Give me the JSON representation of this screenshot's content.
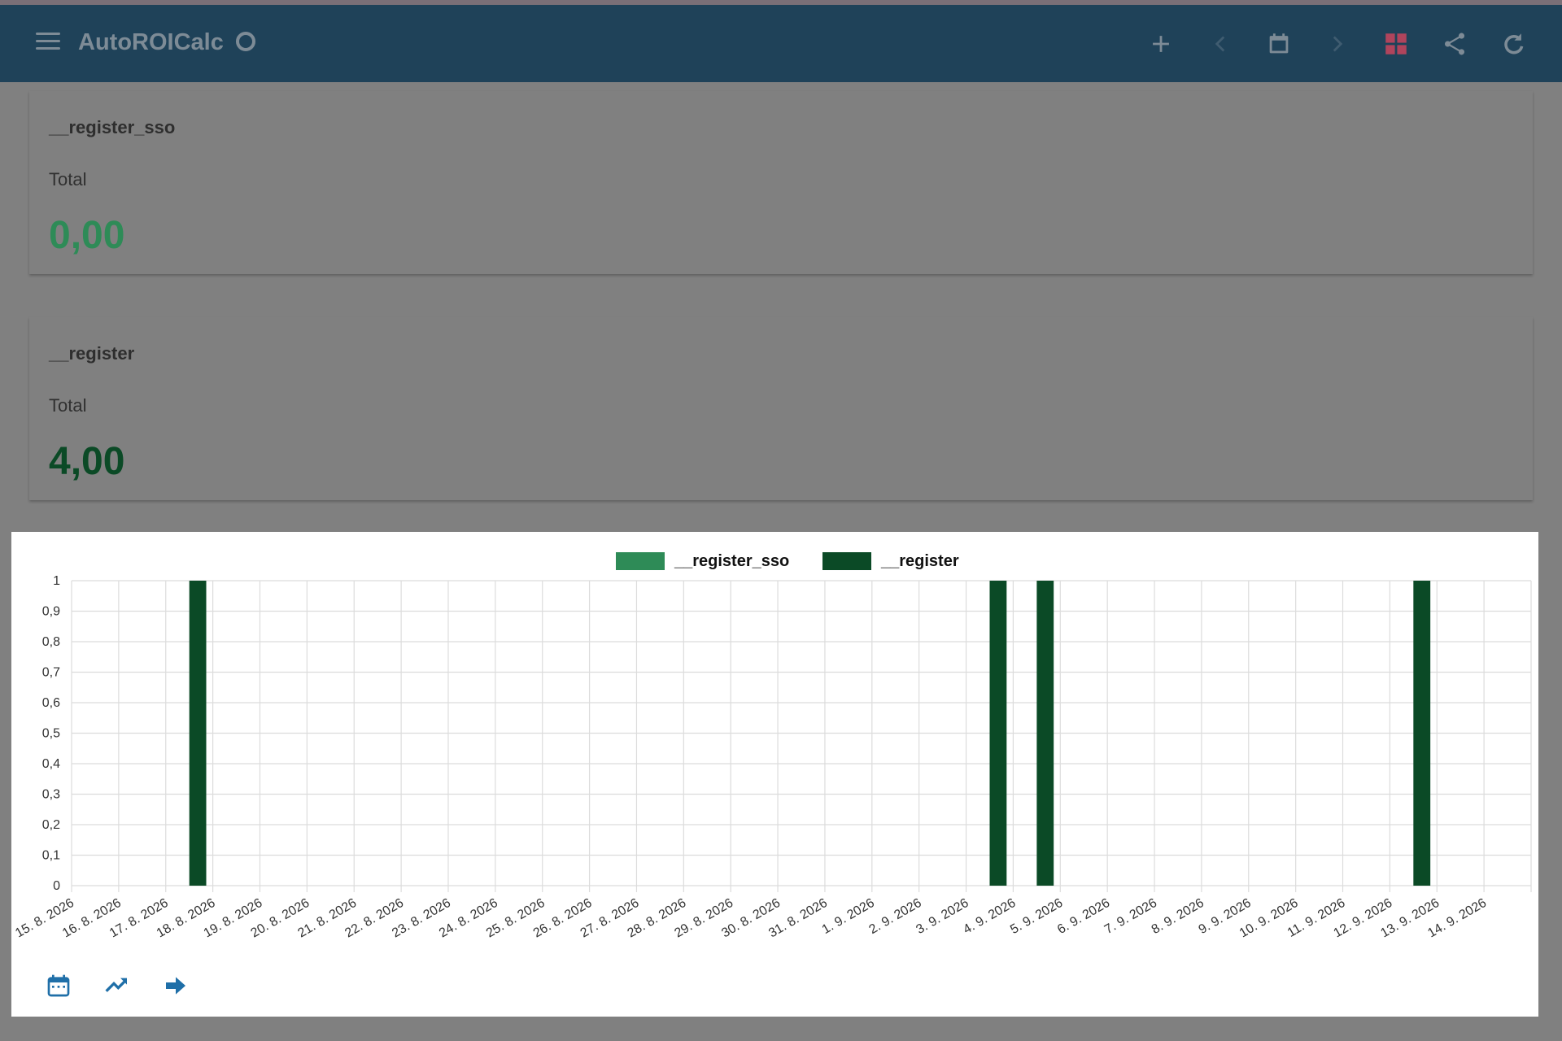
{
  "app": {
    "title": "AutoROICalc"
  },
  "toolbar": {
    "icons": [
      "menu-icon",
      "loading-spinner-icon",
      "add-icon",
      "chevron-left-icon",
      "calendar-icon",
      "chevron-right-icon",
      "dashboard-icon",
      "share-icon",
      "refresh-icon"
    ]
  },
  "cards": [
    {
      "name": "__register_sso",
      "label": "Total",
      "value": "0,00",
      "color": "#2e8b57"
    },
    {
      "name": "__register",
      "label": "Total",
      "value": "4,00",
      "color": "#0b4a26"
    }
  ],
  "chart_data": {
    "type": "bar",
    "categories": [
      "15. 8. 2026",
      "16. 8. 2026",
      "17. 8. 2026",
      "18. 8. 2026",
      "19. 8. 2026",
      "20. 8. 2026",
      "21. 8. 2026",
      "22. 8. 2026",
      "23. 8. 2026",
      "24. 8. 2026",
      "25. 8. 2026",
      "26. 8. 2026",
      "27. 8. 2026",
      "28. 8. 2026",
      "29. 8. 2026",
      "30. 8. 2026",
      "31. 8. 2026",
      "1. 9. 2026",
      "2. 9. 2026",
      "3. 9. 2026",
      "4. 9. 2026",
      "5. 9. 2026",
      "6. 9. 2026",
      "7. 9. 2026",
      "8. 9. 2026",
      "9. 9. 2026",
      "10. 9. 2026",
      "11. 9. 2026",
      "12. 9. 2026",
      "13. 9. 2026",
      "14. 9. 2026"
    ],
    "series": [
      {
        "name": "__register_sso",
        "color": "#2e8b57",
        "values": [
          0,
          0,
          0,
          0,
          0,
          0,
          0,
          0,
          0,
          0,
          0,
          0,
          0,
          0,
          0,
          0,
          0,
          0,
          0,
          0,
          0,
          0,
          0,
          0,
          0,
          0,
          0,
          0,
          0,
          0,
          0
        ]
      },
      {
        "name": "__register",
        "color": "#0b4a26",
        "values": [
          0,
          0,
          1,
          0,
          0,
          0,
          0,
          0,
          0,
          0,
          0,
          0,
          0,
          0,
          0,
          0,
          0,
          0,
          0,
          1,
          1,
          0,
          0,
          0,
          0,
          0,
          0,
          0,
          1,
          0,
          0
        ]
      }
    ],
    "yticks": [
      "0",
      "0,1",
      "0,2",
      "0,3",
      "0,4",
      "0,5",
      "0,6",
      "0,7",
      "0,8",
      "0,9",
      "1"
    ],
    "ylim": [
      0,
      1
    ],
    "grid": true,
    "legend": "top-center"
  },
  "chart_footer": {
    "icons": [
      "calendar-icon",
      "trending-up-icon",
      "arrow-right-icon"
    ]
  }
}
